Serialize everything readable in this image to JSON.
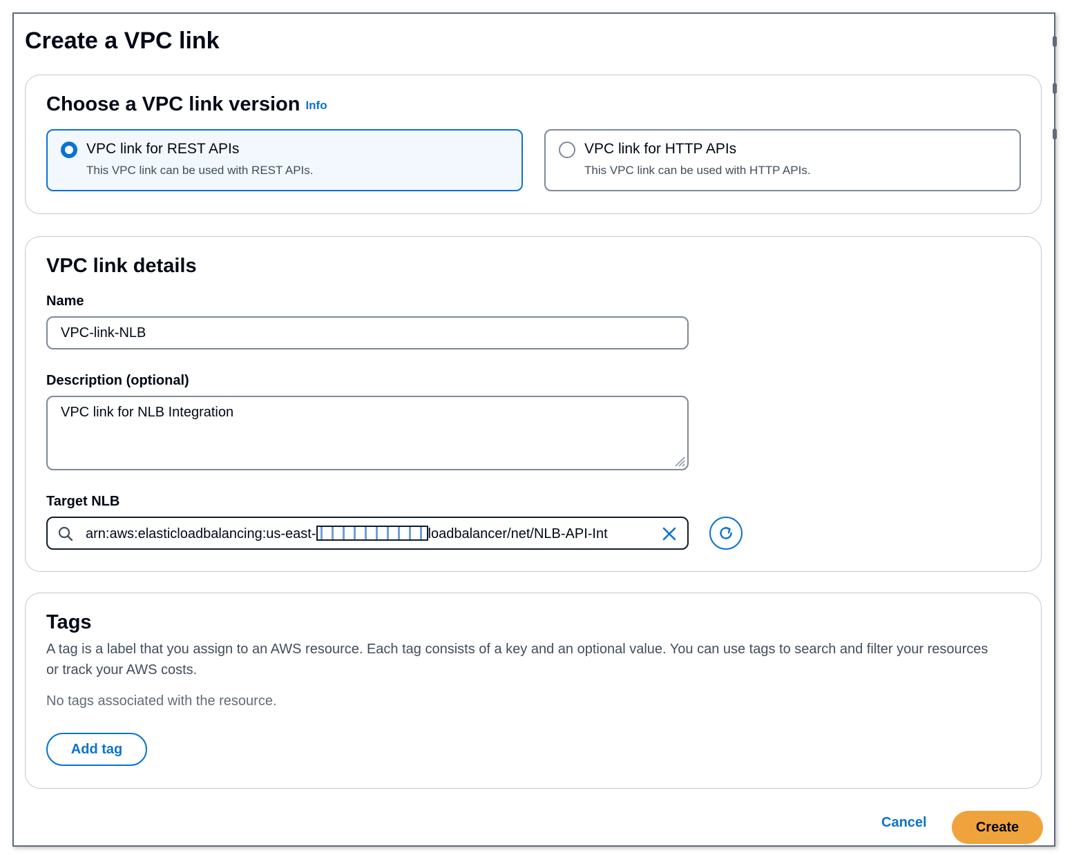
{
  "page": {
    "title": "Create a VPC link"
  },
  "version": {
    "heading": "Choose a VPC link version",
    "info_label": "Info",
    "options": [
      {
        "title": "VPC link for REST APIs",
        "description": "This VPC link can be used with REST APIs.",
        "selected": true
      },
      {
        "title": "VPC link for HTTP APIs",
        "description": "This VPC link can be used with HTTP APIs.",
        "selected": false
      }
    ]
  },
  "details": {
    "heading": "VPC link details",
    "name_label": "Name",
    "name_value": "VPC-link-NLB",
    "description_label": "Description (optional)",
    "description_value": "VPC link for NLB Integration",
    "target_label": "Target NLB",
    "target_value_prefix": "arn:aws:elasticloadbalancing:us-east-",
    "target_value_suffix": "loadbalancer/net/NLB-API-Int"
  },
  "tags": {
    "heading": "Tags",
    "description": "A tag is a label that you assign to an AWS resource. Each tag consists of a key and an optional value. You can use tags to search and filter your resources or track your AWS costs.",
    "empty_text": "No tags associated with the resource.",
    "add_label": "Add tag"
  },
  "footer": {
    "cancel_label": "Cancel",
    "create_label": "Create"
  },
  "icons": {
    "search": "search-icon",
    "clear": "close-icon",
    "refresh": "refresh-icon"
  },
  "colors": {
    "accent": "#0972d3",
    "primary_button": "#f0a33c",
    "text": "#000716"
  }
}
